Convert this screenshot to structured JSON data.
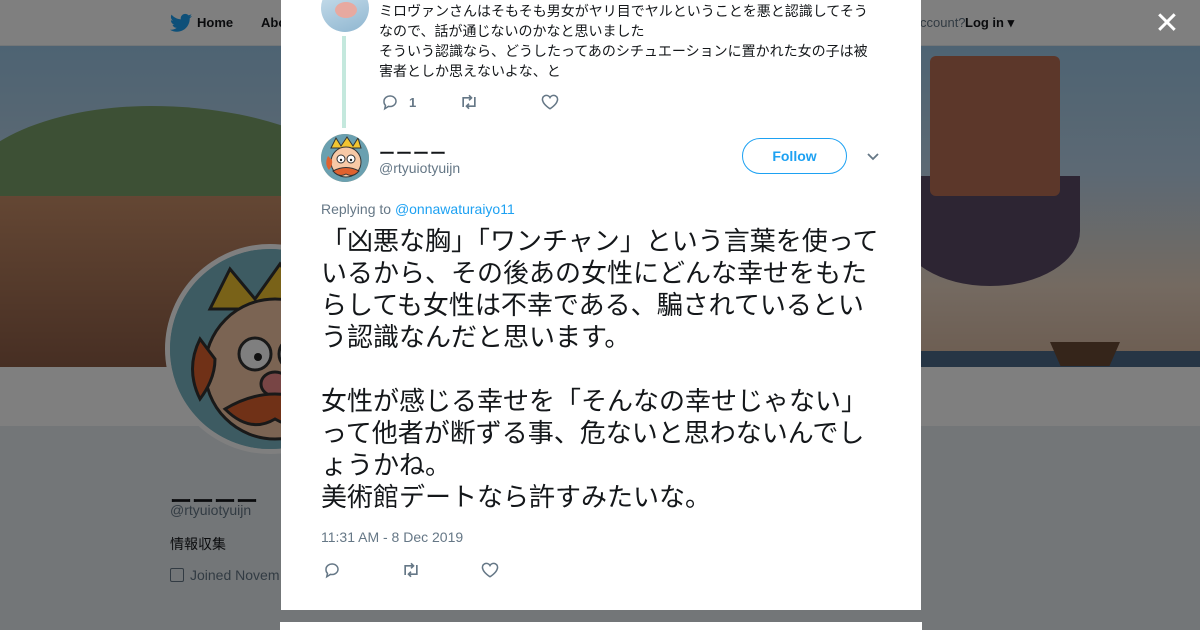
{
  "topbar": {
    "home_label": "Home",
    "about_label": "Abo",
    "account_text": "ccount?",
    "login_label": "Log in"
  },
  "profile": {
    "name": "ーーーー",
    "handle": "@rtyuiotyuijn",
    "bio": "情報収集",
    "joined": "Joined Novem"
  },
  "modal": {
    "close_label": "✕",
    "previous_tweet": {
      "lines": [
        "ミロヴァンさんはそもそも男女がヤリ目でヤルということを悪と認識してそう",
        "なので、話が通じないのかなと思いました",
        "そういう認識なら、どうしたってあのシチュエーションに置かれた女の子は被",
        "害者としか思えないよな、と"
      ],
      "reply_count": "1"
    },
    "tweet": {
      "author_name": "ーーーー",
      "author_handle": "@rtyuiotyuijn",
      "follow_label": "Follow",
      "replying_to_label": "Replying to",
      "replying_to_handle": "@onnawaturaiyo11",
      "paragraph1": "「凶悪な胸」「ワンチャン」という言葉を使っているから、その後あの女性にどんな幸せをもたらしても女性は不幸である、騙されているという認識なんだと思います。",
      "paragraph2": "女性が感じる幸せを「そんなの幸せじゃない」って他者が断ずる事、危ないと思わないんでしょうかね。",
      "paragraph3": "美術館デートなら許すみたいな。",
      "timestamp": "11:31 AM - 8 Dec 2019"
    }
  },
  "colors": {
    "accent": "#1da1f2",
    "text": "#14171a",
    "muted": "#657786",
    "thread_line": "#c4e8dd"
  }
}
